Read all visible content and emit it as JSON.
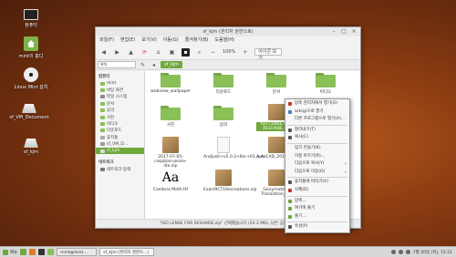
{
  "desktop": {
    "icons": [
      {
        "label": "컴퓨터",
        "icon": "computer-icon"
      },
      {
        "label": "mint의 홈디",
        "icon": "home-folder-icon"
      },
      {
        "label": "Linux Mint 설치",
        "icon": "install-disc-icon"
      },
      {
        "label": "sf_VM_Document",
        "icon": "drive-icon"
      },
      {
        "label": "sf_kjm",
        "icon": "drive-icon"
      }
    ]
  },
  "window": {
    "title": "sf_kjm (관리자 권한으로)",
    "menu": [
      "파일(F)",
      "편집(E)",
      "보기(V)",
      "이동(G)",
      "즐겨찾기(B)",
      "도움말(H)"
    ],
    "zoom": "100%",
    "view_mode": "아이콘 보기",
    "location_dropdown": "위치",
    "breadcrumb_current": "sf_kjm",
    "sidebar": {
      "computer_header": "컴퓨터",
      "network_header": "네트워크",
      "items": [
        "mint",
        "바탕 화면",
        "파일 시스템",
        "문서",
        "음악",
        "사진",
        "비디오",
        "다운로드",
        "휴지통",
        "sf_VM_D...",
        "sf_kjm"
      ],
      "network_items": [
        "네트워크 탐색"
      ]
    },
    "files": [
      {
        "name": "webview_wallpaper",
        "kind": "folder"
      },
      {
        "name": "다운로드",
        "kind": "folder"
      },
      {
        "name": "문서",
        "kind": "folder"
      },
      {
        "name": "비디오",
        "kind": "folder"
      },
      {
        "name": "사진",
        "kind": "folder"
      },
      {
        "name": "음악",
        "kind": "folder"
      },
      {
        "name": "ISO LENSE FOR RESHADE.zip",
        "kind": "archive",
        "selected": true
      },
      {
        "name": "2017-07-05-raspbian-jessie-lite.zip",
        "kind": "archive"
      },
      {
        "name": "Andjusti+v5.0.2+Kor+R1.apk",
        "kind": "doc"
      },
      {
        "name": "AutoCAD_2014_Win_64bit_dlm...",
        "kind": "archive"
      },
      {
        "name": "Cambria Math.ttf",
        "kind": "font"
      },
      {
        "name": "Exact9CT1Recreations.zip",
        "kind": "archive"
      },
      {
        "name": "Genymotion-Translation_v...",
        "kind": "archive"
      }
    ],
    "font_preview": "Aa",
    "status": "\"ISO LENSE FOR RESHADE.zip\" 선택했습니다 (24.2 MB), 남은 공간: 96.3 GB"
  },
  "context_menu": {
    "items": [
      {
        "label": "압축 관리자에서 열기(O)",
        "color": "#c0392b"
      },
      {
        "label": "ark(g)으로 열기",
        "color": "#4a7bc8"
      },
      {
        "label": "다른 프로그램으로 열기(A)...",
        "color": ""
      },
      {
        "sep": true
      },
      {
        "label": "잘라내기(T)",
        "color": "#555555"
      },
      {
        "label": "복사(C)",
        "color": "#555555"
      },
      {
        "sep": true
      },
      {
        "label": "링크 만들기(K)",
        "color": ""
      },
      {
        "label": "이름 바꾸기(R)...",
        "color": ""
      },
      {
        "label": "다음으로 복사(Y)",
        "color": "",
        "submenu": true
      },
      {
        "label": "다음으로 이동(O)",
        "color": "",
        "submenu": true
      },
      {
        "sep": true
      },
      {
        "label": "휴지통에 버리기(V)",
        "color": "#555555"
      },
      {
        "label": "삭제(D)",
        "color": "#c0392b"
      },
      {
        "sep": true
      },
      {
        "label": "압축...",
        "color": "#6fa83b"
      },
      {
        "label": "여기에 풀기",
        "color": "#6fa83b"
      },
      {
        "label": "풀기...",
        "color": "#6fa83b"
      },
      {
        "sep": true
      },
      {
        "label": "속성(P)",
        "color": "#555555"
      }
    ]
  },
  "taskbar": {
    "menu_label": "메뉴",
    "tasks": [
      "mint@mint...",
      "sf_kjm (관리자 권한으...)"
    ],
    "clock": "7월 20일 (목), 15:21"
  }
}
